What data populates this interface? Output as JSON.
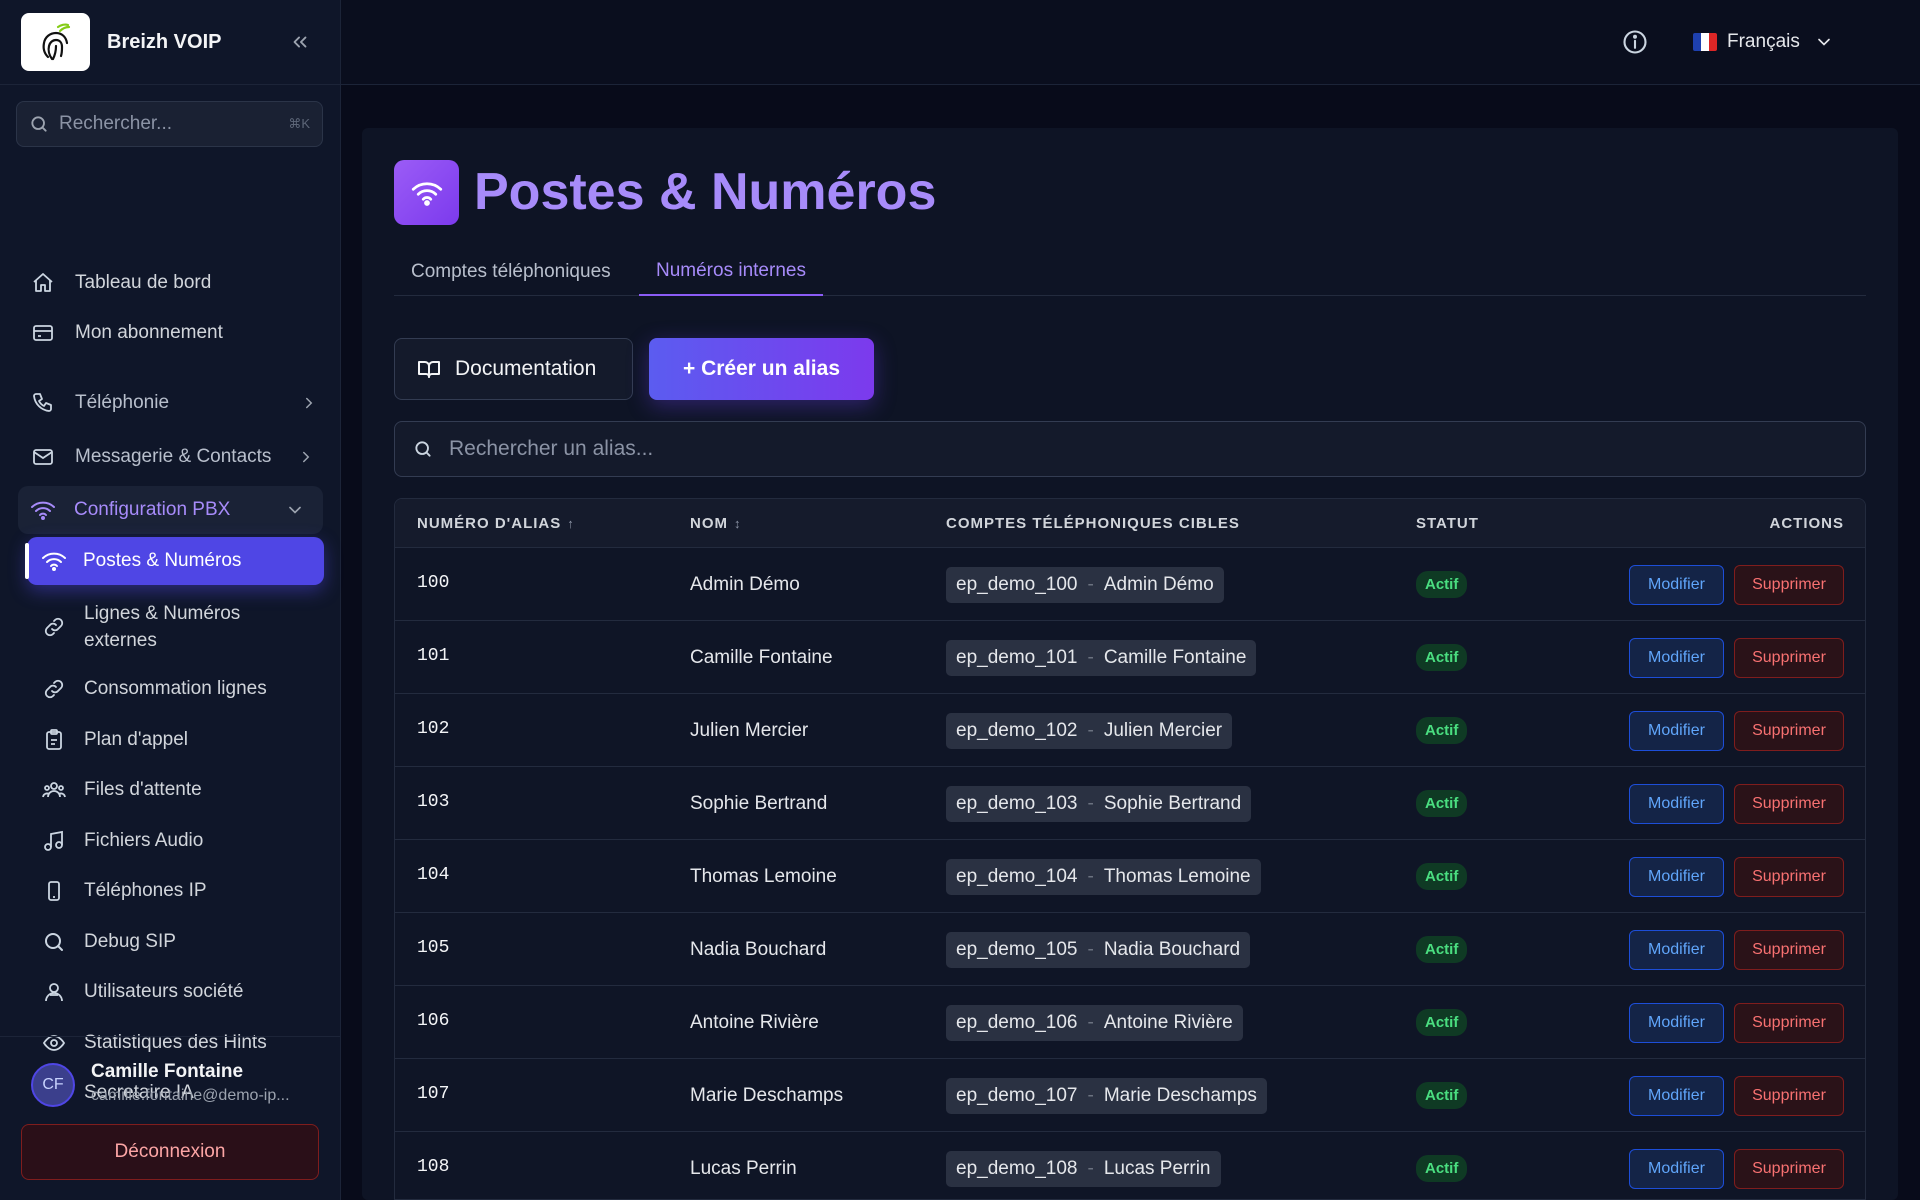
{
  "brand": {
    "name": "Breizh VOIP",
    "logo_icon": "fingerprint-icon"
  },
  "sidebar": {
    "search_placeholder": "Rechercher...",
    "search_shortcut": "⌘K",
    "items": [
      {
        "label": "Tableau de bord",
        "icon": "home-icon"
      },
      {
        "label": "Mon abonnement",
        "icon": "credit-card-icon"
      },
      {
        "label": "Téléphonie",
        "icon": "phone-icon"
      },
      {
        "label": "Messagerie & Contacts",
        "icon": "mail-icon"
      },
      {
        "label": "Configuration PBX",
        "icon": "wifi-icon"
      },
      {
        "label": "Postes & Numéros",
        "icon": "wifi-icon"
      },
      {
        "label": "Lignes & Numéros externes",
        "icon": "link-icon"
      },
      {
        "label": "Consommation lignes",
        "icon": "link-icon"
      },
      {
        "label": "Plan d'appel",
        "icon": "clipboard-icon"
      },
      {
        "label": "Files d'attente",
        "icon": "users-icon"
      },
      {
        "label": "Fichiers Audio",
        "icon": "music-icon"
      },
      {
        "label": "Téléphones IP",
        "icon": "smartphone-icon"
      },
      {
        "label": "Debug SIP",
        "icon": "search-icon"
      },
      {
        "label": "Utilisateurs société",
        "icon": "user-group-icon"
      },
      {
        "label": "Statistiques des Hints",
        "icon": "eye-icon"
      },
      {
        "label": "Secretaire IA",
        "icon": "flask-icon"
      }
    ]
  },
  "user": {
    "initials": "CF",
    "name": "Camille Fontaine",
    "email": "camille.fontaine@demo-ip...",
    "logout_label": "Déconnexion"
  },
  "topbar": {
    "language": "Français"
  },
  "page": {
    "title": "Postes & Numéros",
    "tabs": [
      {
        "label": "Comptes téléphoniques",
        "active": false
      },
      {
        "label": "Numéros internes",
        "active": true
      }
    ],
    "documentation_label": "Documentation",
    "create_label": "+ Créer un alias",
    "search_placeholder": "Rechercher un alias..."
  },
  "table": {
    "columns": {
      "number": "NUMÉRO D'ALIAS",
      "name": "NOM",
      "targets": "COMPTES TÉLÉPHONIQUES CIBLES",
      "status": "STATUT",
      "actions": "ACTIONS"
    },
    "sort_number": "↑",
    "sort_name": "↕",
    "target_separator": "-",
    "edit_label": "Modifier",
    "delete_label": "Supprimer",
    "rows": [
      {
        "number": "100",
        "name": "Admin Démo",
        "account": "ep_demo_100",
        "account_name": "Admin Démo",
        "status": "Actif"
      },
      {
        "number": "101",
        "name": "Camille Fontaine",
        "account": "ep_demo_101",
        "account_name": "Camille Fontaine",
        "status": "Actif"
      },
      {
        "number": "102",
        "name": "Julien Mercier",
        "account": "ep_demo_102",
        "account_name": "Julien Mercier",
        "status": "Actif"
      },
      {
        "number": "103",
        "name": "Sophie Bertrand",
        "account": "ep_demo_103",
        "account_name": "Sophie Bertrand",
        "status": "Actif"
      },
      {
        "number": "104",
        "name": "Thomas Lemoine",
        "account": "ep_demo_104",
        "account_name": "Thomas Lemoine",
        "status": "Actif"
      },
      {
        "number": "105",
        "name": "Nadia Bouchard",
        "account": "ep_demo_105",
        "account_name": "Nadia Bouchard",
        "status": "Actif"
      },
      {
        "number": "106",
        "name": "Antoine Rivière",
        "account": "ep_demo_106",
        "account_name": "Antoine Rivière",
        "status": "Actif"
      },
      {
        "number": "107",
        "name": "Marie Deschamps",
        "account": "ep_demo_107",
        "account_name": "Marie Deschamps",
        "status": "Actif"
      },
      {
        "number": "108",
        "name": "Lucas Perrin",
        "account": "ep_demo_108",
        "account_name": "Lucas Perrin",
        "status": "Actif"
      }
    ]
  },
  "colors": {
    "accent": "#a78bfa",
    "primary": "#4f46e5",
    "active_status": "#4ade80",
    "danger": "#f87171",
    "edit": "#60a5fa"
  }
}
